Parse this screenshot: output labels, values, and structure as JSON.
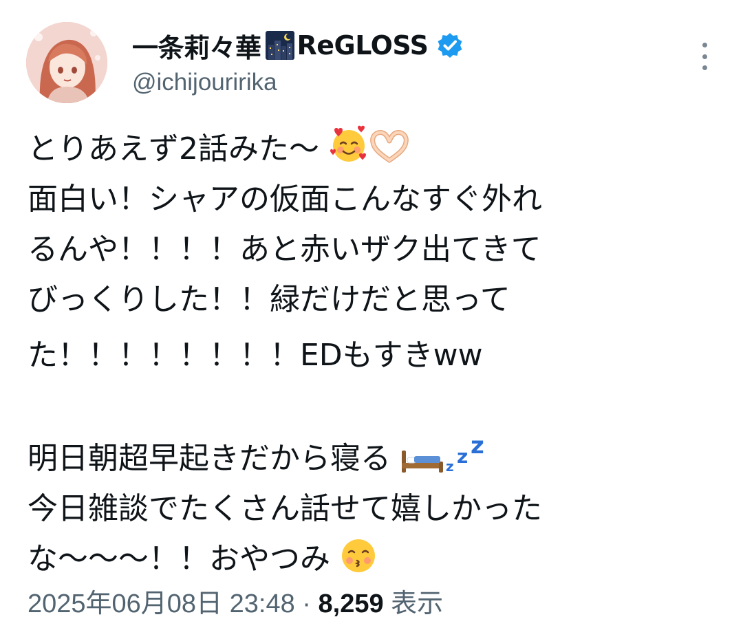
{
  "user": {
    "display_name_prefix": "一条莉々華",
    "display_name_suffix": "ReGLOSS",
    "handle": "@ichijouririka",
    "verified": true,
    "icons": [
      "night-city-icon",
      "verified-badge-icon"
    ]
  },
  "tweet": {
    "lines": [
      "とりあえず2話みた〜",
      "面白い！シャアの仮面こんなすぐ外れ",
      "るんや！！！！あと赤いザク出てきて",
      "びっくりした！！緑だけだと思って",
      "た！！！！！！！！EDもすきww",
      "",
      "明日朝超早起きだから寝る",
      "今日雑談でたくさん話せて嬉しかった",
      "な〜〜〜！！おやつみ"
    ],
    "emoji_names": [
      "smiling-face-with-hearts-icon",
      "heart-hands-icon",
      "bed-icon",
      "zzz-icon",
      "kissing-face-icon"
    ]
  },
  "meta": {
    "timestamp": "2025年06月08日 23:48",
    "separator": "·",
    "views_count": "8,259",
    "views_label": "表示"
  },
  "colors": {
    "text_primary": "#0f1419",
    "text_secondary": "#536471",
    "verified_blue": "#1d9bf0"
  }
}
